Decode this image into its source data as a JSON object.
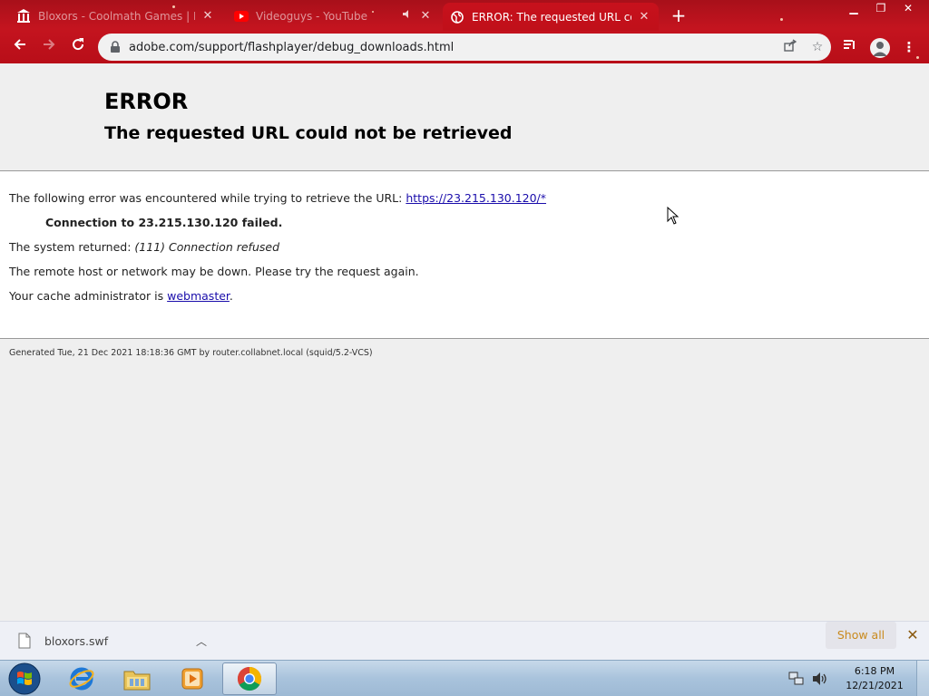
{
  "browser": {
    "tabs": [
      {
        "title": "Bloxors - Coolmath Games | Free",
        "active": false,
        "muted": false
      },
      {
        "title": "Videoguys - YouTube",
        "active": false,
        "muted": true
      },
      {
        "title": "ERROR: The requested URL could not be retrieved",
        "active": true,
        "muted": false
      }
    ],
    "url": "adobe.com/support/flashplayer/debug_downloads.html"
  },
  "page": {
    "title": "ERROR",
    "subtitle": "The requested URL could not be retrieved",
    "line1_prefix": "The following error was encountered while trying to retrieve the URL: ",
    "line1_link": "https://23.215.130.120/*",
    "connection_failed": "Connection to 23.215.130.120 failed.",
    "system_returned_prefix": "The system returned: ",
    "system_returned_value": "(111) Connection refused",
    "remote_host_line": "The remote host or network may be down. Please try the request again.",
    "cache_admin_prefix": "Your cache administrator is ",
    "cache_admin_link": "webmaster",
    "cache_admin_suffix": ".",
    "footer": "Generated Tue, 21 Dec 2021 18:18:36 GMT by router.collabnet.local (squid/5.2-VCS)"
  },
  "downloads": {
    "file_name": "bloxors.swf",
    "show_all_label": "Show all"
  },
  "taskbar": {
    "time": "6:18 PM",
    "date": "12/21/2021"
  },
  "colors": {
    "chrome_theme": "#c20f18",
    "link": "#1a0dab",
    "show_all_text": "#c98a1d"
  }
}
